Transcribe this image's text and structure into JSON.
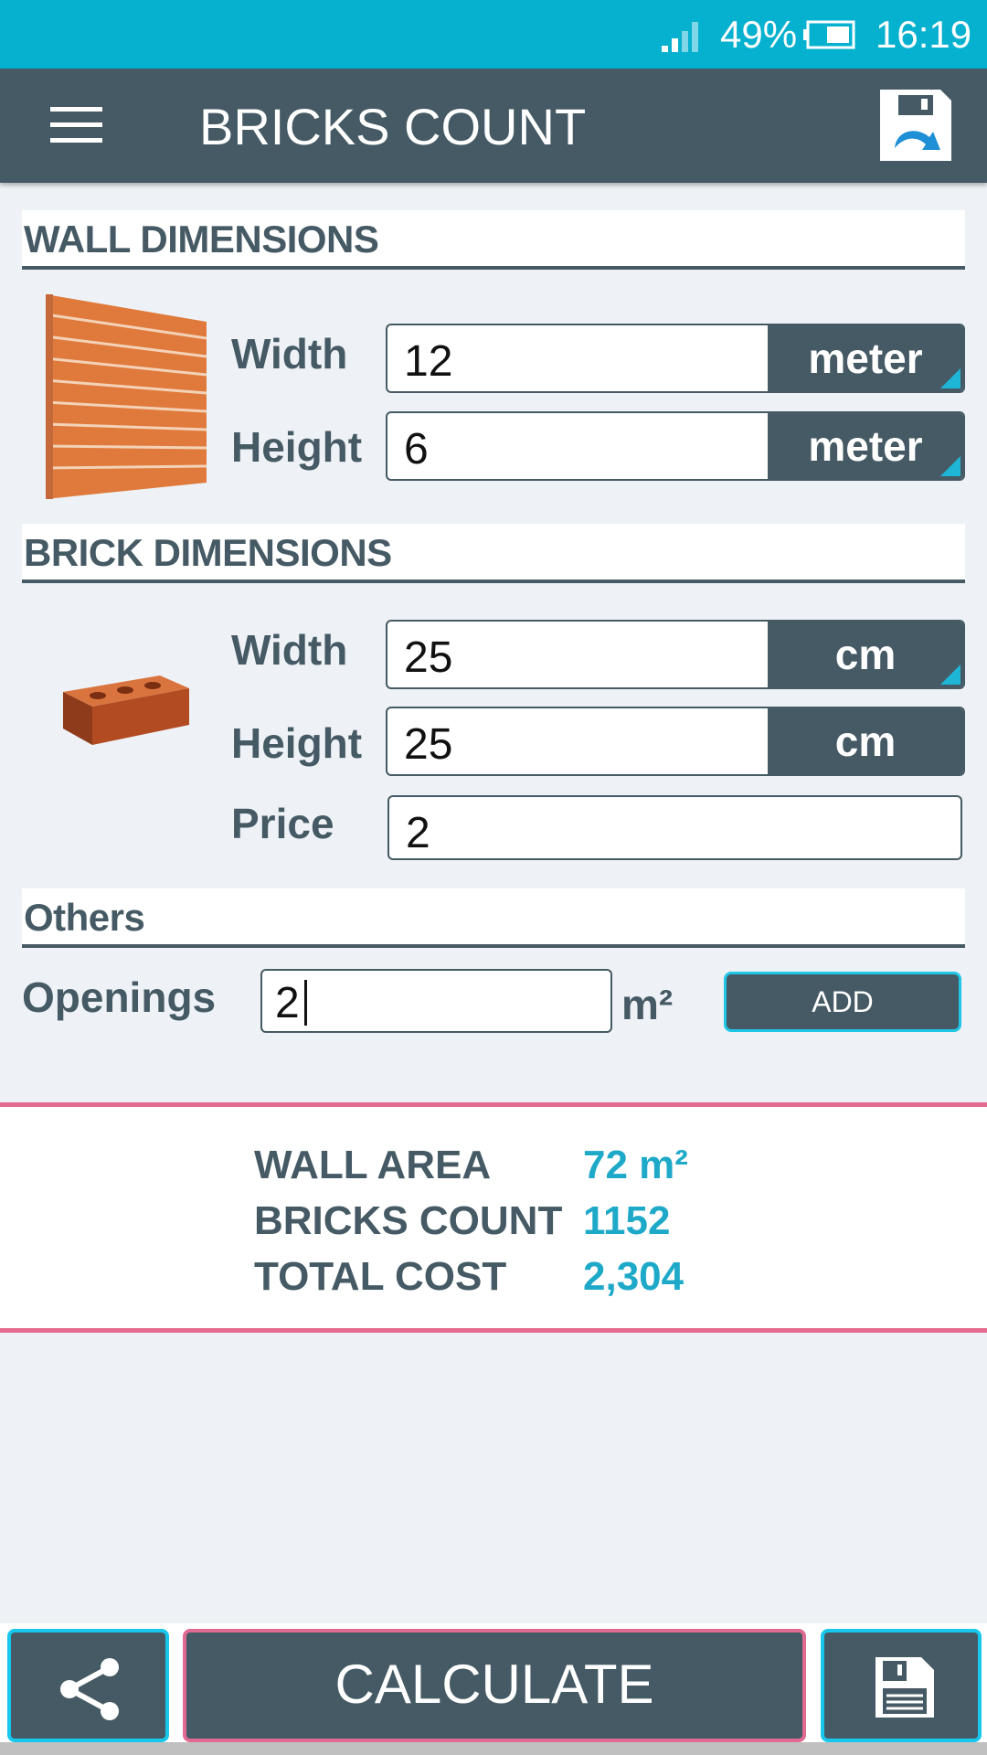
{
  "status": {
    "battery": "49%",
    "time": "16:19"
  },
  "toolbar": {
    "title": "BRICKS COUNT"
  },
  "wall": {
    "header": "WALL DIMENSIONS",
    "width_label": "Width",
    "width_value": "12",
    "width_unit": "meter",
    "height_label": "Height",
    "height_value": "6",
    "height_unit": "meter"
  },
  "brick": {
    "header": "BRICK DIMENSIONS",
    "width_label": "Width",
    "width_value": "25",
    "width_unit": "cm",
    "height_label": "Height",
    "height_value": "25",
    "height_unit": "cm",
    "price_label": "Price",
    "price_value": "2"
  },
  "others": {
    "header": "Others",
    "openings_label": "Openings",
    "openings_value": "2",
    "openings_unit": "m²",
    "add_label": "ADD"
  },
  "results": {
    "wall_area_label": "WALL AREA",
    "wall_area_value": "72 m²",
    "bricks_count_label": "BRICKS COUNT",
    "bricks_count_value": "1152",
    "total_cost_label": "TOTAL COST",
    "total_cost_value": "2,304"
  },
  "bottom": {
    "calculate_label": "CALCULATE"
  },
  "colors": {
    "status_bar": "#06b0cf",
    "toolbar": "#455a64",
    "accent_cyan": "#1fa9c9",
    "accent_pink": "#e56a90"
  }
}
